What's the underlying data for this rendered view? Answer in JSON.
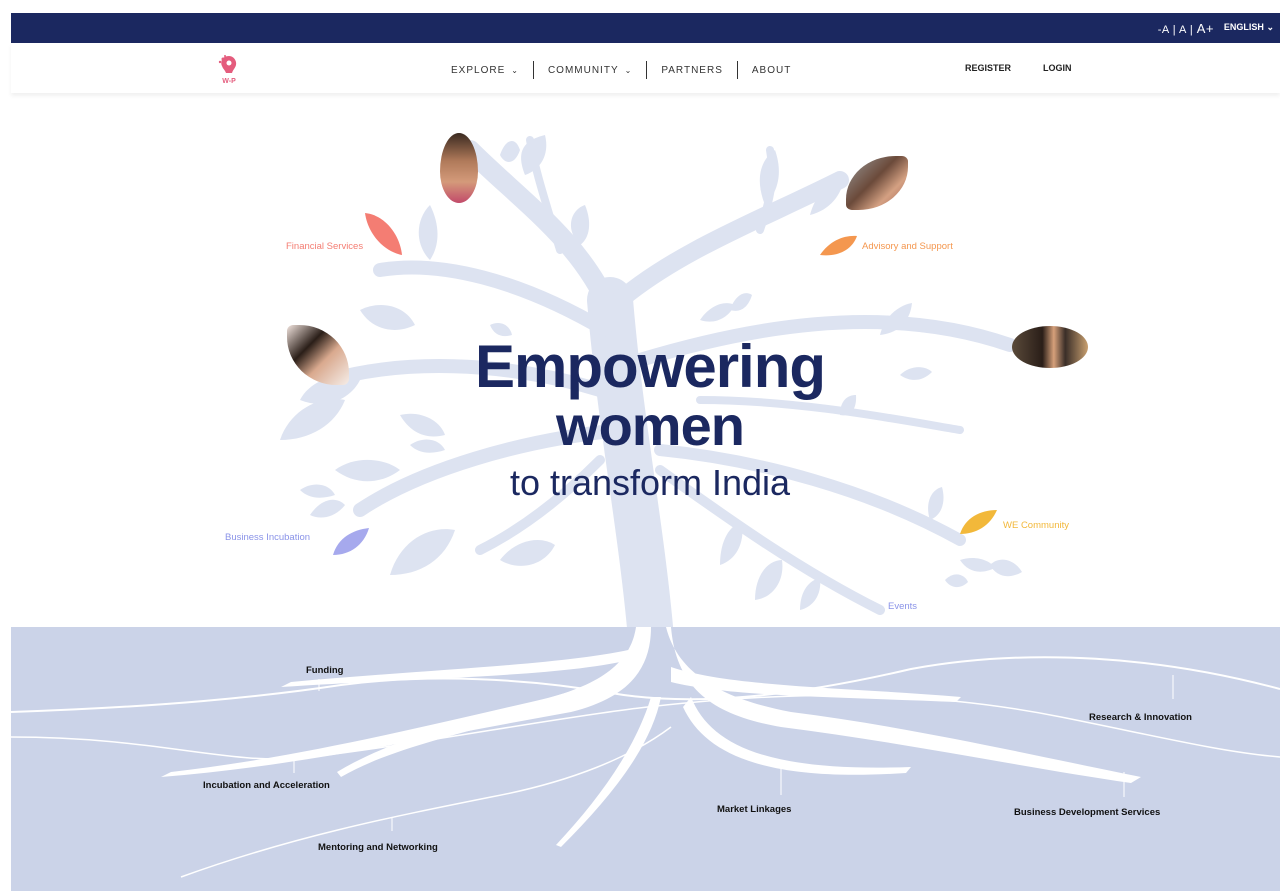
{
  "topbar": {
    "font_small": "-A",
    "font_normal": "A",
    "font_large": "A+",
    "language": "ENGLISH",
    "sep1": "|",
    "sep2": "|"
  },
  "nav": {
    "logo_text": "W-P",
    "items": [
      {
        "label": "EXPLORE",
        "has_dropdown": true
      },
      {
        "label": "COMMUNITY",
        "has_dropdown": true
      },
      {
        "label": "PARTNERS",
        "has_dropdown": false
      },
      {
        "label": "ABOUT",
        "has_dropdown": false
      }
    ],
    "register": "REGISTER",
    "login": "LOGIN"
  },
  "hero": {
    "line1": "Empowering",
    "line2": "women",
    "line3": "to transform India",
    "branches": [
      {
        "label": "Financial Services",
        "color": "#f47d73"
      },
      {
        "label": "Advisory and Support",
        "color": "#f4974f"
      },
      {
        "label": "Business Incubation",
        "color": "#8a93e8"
      },
      {
        "label": "WE Community",
        "color": "#f2b83a"
      },
      {
        "label": "Events",
        "color": "#8a93e8"
      }
    ]
  },
  "roots": {
    "labels": [
      "Funding",
      "Incubation and Acceleration",
      "Mentoring and Networking",
      "Market Linkages",
      "Research & Innovation",
      "Business Development Services"
    ]
  },
  "colors": {
    "navy": "#1b2860",
    "tree": "#dde3f1",
    "roots_bg": "#cbd3e8"
  }
}
